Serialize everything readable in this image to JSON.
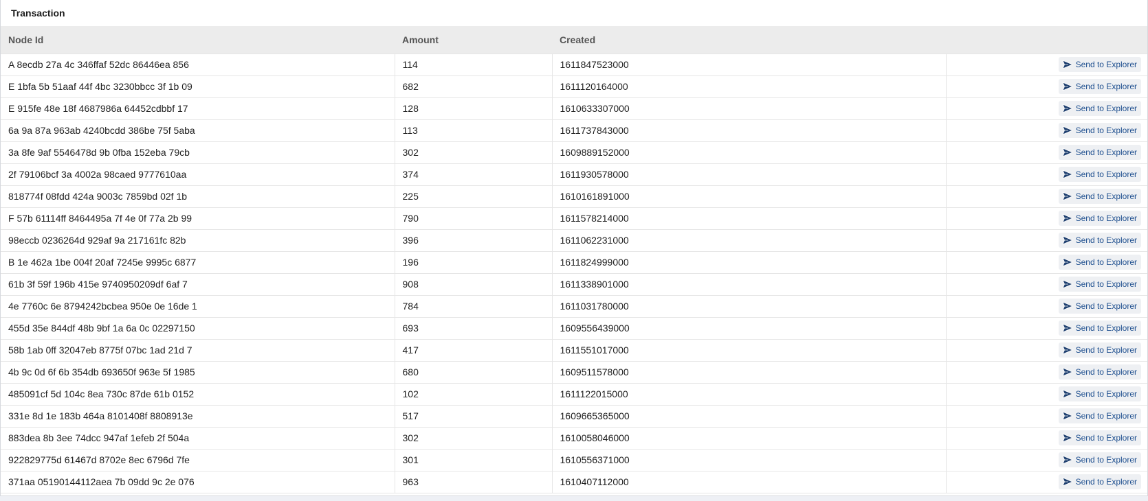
{
  "panel": {
    "title": "Transaction"
  },
  "table": {
    "columns": [
      "Node Id",
      "Amount",
      "Created",
      ""
    ],
    "action_label": "Send to Explorer",
    "action_icon": "send-icon",
    "rows": [
      {
        "node_id": "A 8ecdb 27a 4c 346ffaf 52dc 86446ea 856",
        "amount": "114",
        "created": "1611847523000"
      },
      {
        "node_id": "E 1bfa 5b 51aaf 44f 4bc 3230bbcc 3f 1b 09",
        "amount": "682",
        "created": "1611120164000"
      },
      {
        "node_id": "E 915fe 48e 18f 4687986a 64452cdbbf 17",
        "amount": "128",
        "created": "1610633307000"
      },
      {
        "node_id": "6a 9a 87a 963ab 4240bcdd 386be 75f 5aba",
        "amount": "113",
        "created": "1611737843000"
      },
      {
        "node_id": "3a 8fe 9af 5546478d 9b 0fba 152eba 79cb",
        "amount": "302",
        "created": "1609889152000"
      },
      {
        "node_id": "2f 79106bcf 3a 4002a 98caed 9777610aa",
        "amount": "374",
        "created": "1611930578000"
      },
      {
        "node_id": "818774f 08fdd 424a 9003c 7859bd 02f 1b",
        "amount": "225",
        "created": "1610161891000"
      },
      {
        "node_id": "F 57b 61114ff 8464495a 7f 4e 0f 77a 2b 99",
        "amount": "790",
        "created": "1611578214000"
      },
      {
        "node_id": "98eccb 0236264d 929af 9a 217161fc 82b",
        "amount": "396",
        "created": "1611062231000"
      },
      {
        "node_id": "B 1e 462a 1be 004f 20af 7245e 9995c 6877",
        "amount": "196",
        "created": "1611824999000"
      },
      {
        "node_id": "61b 3f 59f 196b 415e 9740950209df 6af 7",
        "amount": "908",
        "created": "1611338901000"
      },
      {
        "node_id": "4e 7760c 6e 8794242bcbea 950e 0e 16de 1",
        "amount": "784",
        "created": "1611031780000"
      },
      {
        "node_id": "455d 35e 844df 48b 9bf 1a 6a 0c 02297150",
        "amount": "693",
        "created": "1609556439000"
      },
      {
        "node_id": "58b 1ab 0ff 32047eb 8775f 07bc 1ad 21d 7",
        "amount": "417",
        "created": "1611551017000"
      },
      {
        "node_id": "4b 9c 0d 6f 6b 354db 693650f 963e 5f 1985",
        "amount": "680",
        "created": "1609511578000"
      },
      {
        "node_id": "485091cf 5d 104c 8ea 730c 87de 61b 0152",
        "amount": "102",
        "created": "1611122015000"
      },
      {
        "node_id": "331e 8d 1e 183b 464a 8101408f 8808913e",
        "amount": "517",
        "created": "1609665365000"
      },
      {
        "node_id": "883dea 8b 3ee 74dcc 947af 1efeb 2f 504a",
        "amount": "302",
        "created": "1610058046000"
      },
      {
        "node_id": "922829775d 61467d 8702e 8ec 6796d 7fe",
        "amount": "301",
        "created": "1610556371000"
      },
      {
        "node_id": "371aa 05190144112aea 7b 09dd 9c 2e 076",
        "amount": "963",
        "created": "1610407112000"
      }
    ]
  },
  "colors": {
    "header_bg": "#ececec",
    "button_bg": "#eef0f3",
    "button_text": "#1e4f8f",
    "icon": "#1e3f6f"
  }
}
